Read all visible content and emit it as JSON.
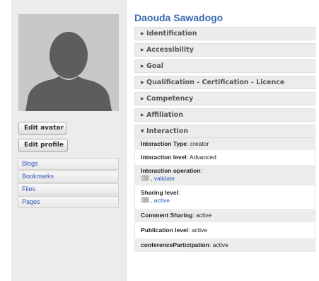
{
  "profile": {
    "name": "Daouda Sawadogo",
    "edit_avatar": "Edit avatar",
    "edit_profile": "Edit profile"
  },
  "tools": [
    {
      "label": "Blogs"
    },
    {
      "label": "Bookmarks"
    },
    {
      "label": "Files"
    },
    {
      "label": "Pages"
    }
  ],
  "sections": {
    "identification": "Identification",
    "accessibility": "Accessibility",
    "goal": "Goal",
    "qualification": "Qualification - Certification - Licence",
    "competency": "Competency",
    "affiliation": "Affiliation",
    "interaction": "Interaction"
  },
  "interaction": {
    "type_key": "Interaction Type",
    "type_value": "creator",
    "level_key": "Interaction level",
    "level_value": "Advanced",
    "operation_key": "Interaction operation",
    "operation_value": "validate",
    "sharing_key": "Sharing level",
    "sharing_value": "active",
    "comment_key": "Comment Sharing",
    "comment_value": "active",
    "publication_key": "Publication level",
    "publication_value": "active",
    "conference_key": "conferenceParticipation",
    "conference_value": "active"
  },
  "colors": {
    "name": "#3a6ab0",
    "link": "#2b55b8",
    "panel": "#ececec"
  },
  "icons": {
    "collapsed": "triangle-right-icon",
    "expanded": "triangle-down-icon",
    "tag": "tag-icon"
  }
}
